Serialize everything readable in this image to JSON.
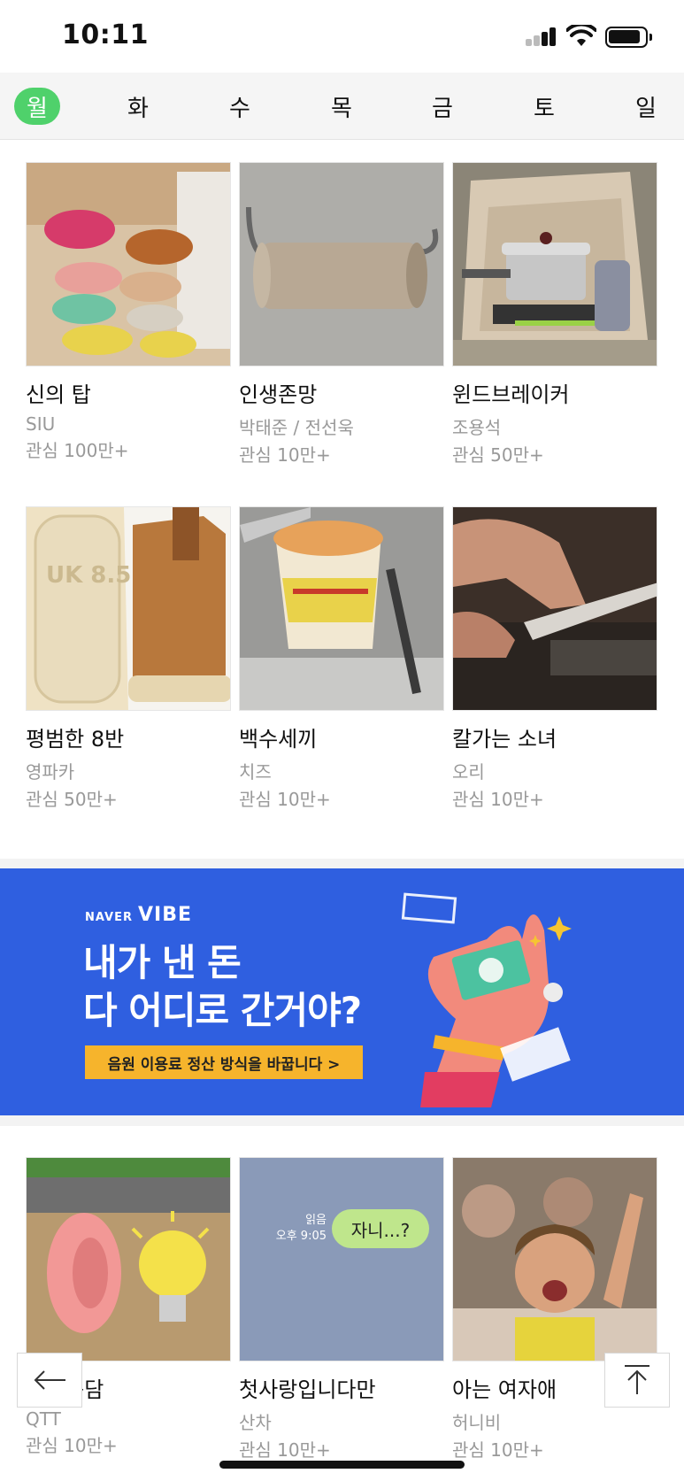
{
  "status_bar": {
    "time": "10:11"
  },
  "day_tabs": [
    {
      "label": "월",
      "active": true
    },
    {
      "label": "화",
      "active": false
    },
    {
      "label": "수",
      "active": false
    },
    {
      "label": "목",
      "active": false
    },
    {
      "label": "금",
      "active": false
    },
    {
      "label": "토",
      "active": false
    },
    {
      "label": "일",
      "active": false
    }
  ],
  "rows": [
    [
      {
        "title": "신의 탑",
        "author": "SIU",
        "interest": "관심 100만+",
        "thumb": "shoes-thumbnail"
      },
      {
        "title": "인생존망",
        "author": "박태준 / 전선욱",
        "interest": "관심 10만+",
        "thumb": "toilet-roll-thumbnail"
      },
      {
        "title": "윈드브레이커",
        "author": "조용석",
        "interest": "관심 50만+",
        "thumb": "camping-stove-thumbnail"
      }
    ],
    [
      {
        "title": "평범한 8반",
        "author": "영파카",
        "interest": "관심 50만+",
        "thumb": "boots-thumbnail"
      },
      {
        "title": "백수세끼",
        "author": "치즈",
        "interest": "관심 10만+",
        "thumb": "cup-noodle-thumbnail"
      },
      {
        "title": "칼가는 소녀",
        "author": "오리",
        "interest": "관심 10만+",
        "thumb": "knife-sharpening-thumbnail"
      }
    ],
    [
      {
        "title": "귀전구담",
        "author": "QTT",
        "interest": "관심 10만+",
        "thumb": "ear-bulb-thumbnail"
      },
      {
        "title": "첫사랑입니다만",
        "author": "산차",
        "interest": "관심 10만+",
        "thumb": "chat-bubble-thumbnail"
      },
      {
        "title": "아는 여자애",
        "author": "허니비",
        "interest": "관심 10만+",
        "thumb": "classroom-girl-thumbnail"
      }
    ]
  ],
  "thumb_text": {
    "uk_size": "UK 8.5",
    "chat_read": "읽음",
    "chat_time": "오후 9:05",
    "chat_bubble": "자니...?"
  },
  "banner": {
    "brand_small": "NAVER",
    "brand": "VIBE",
    "headline_1": "내가 낸 돈",
    "headline_2": "다 어디로 간거야?",
    "cta": "음원 이용료 정산 방식을 바꿉니다 >",
    "bg_color": "#2f5fe0",
    "cta_color": "#f6b42c"
  },
  "controls": {
    "back_icon": "back-arrow-icon",
    "top_icon": "scroll-top-icon"
  },
  "colors": {
    "accent": "#4fd16b",
    "muted_text": "#999999"
  }
}
